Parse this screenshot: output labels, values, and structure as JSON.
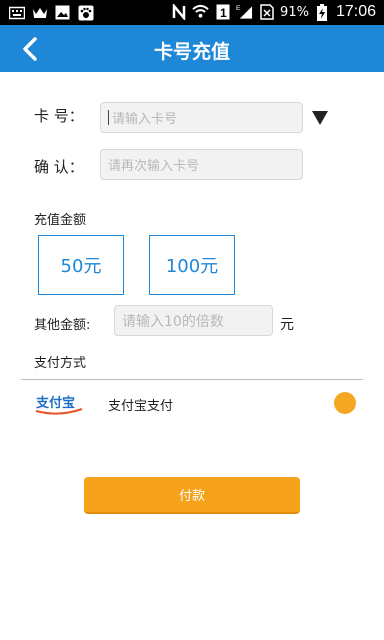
{
  "status_bar": {
    "battery": "91%",
    "time": "17:06"
  },
  "header": {
    "title": "卡号充值"
  },
  "form": {
    "card_label": "卡  号：",
    "card_placeholder": "请输入卡号",
    "confirm_label": "确  认：",
    "confirm_placeholder": "请再次输入卡号",
    "amount_section": "充值金额",
    "amounts": [
      "50元",
      "100元"
    ],
    "other_label": "其他金额:",
    "other_placeholder": "请输入10的倍数",
    "other_unit": "元",
    "pay_method_section": "支付方式"
  },
  "payment": {
    "logo_text": "支付宝",
    "name": "支付宝支付",
    "selected": true
  },
  "actions": {
    "pay_label": "付款"
  },
  "colors": {
    "primary": "#1e87d7",
    "accent": "#f7a21b"
  },
  "icons": {
    "back": "chevron-left-icon",
    "dropdown": "triangle-down-icon"
  }
}
